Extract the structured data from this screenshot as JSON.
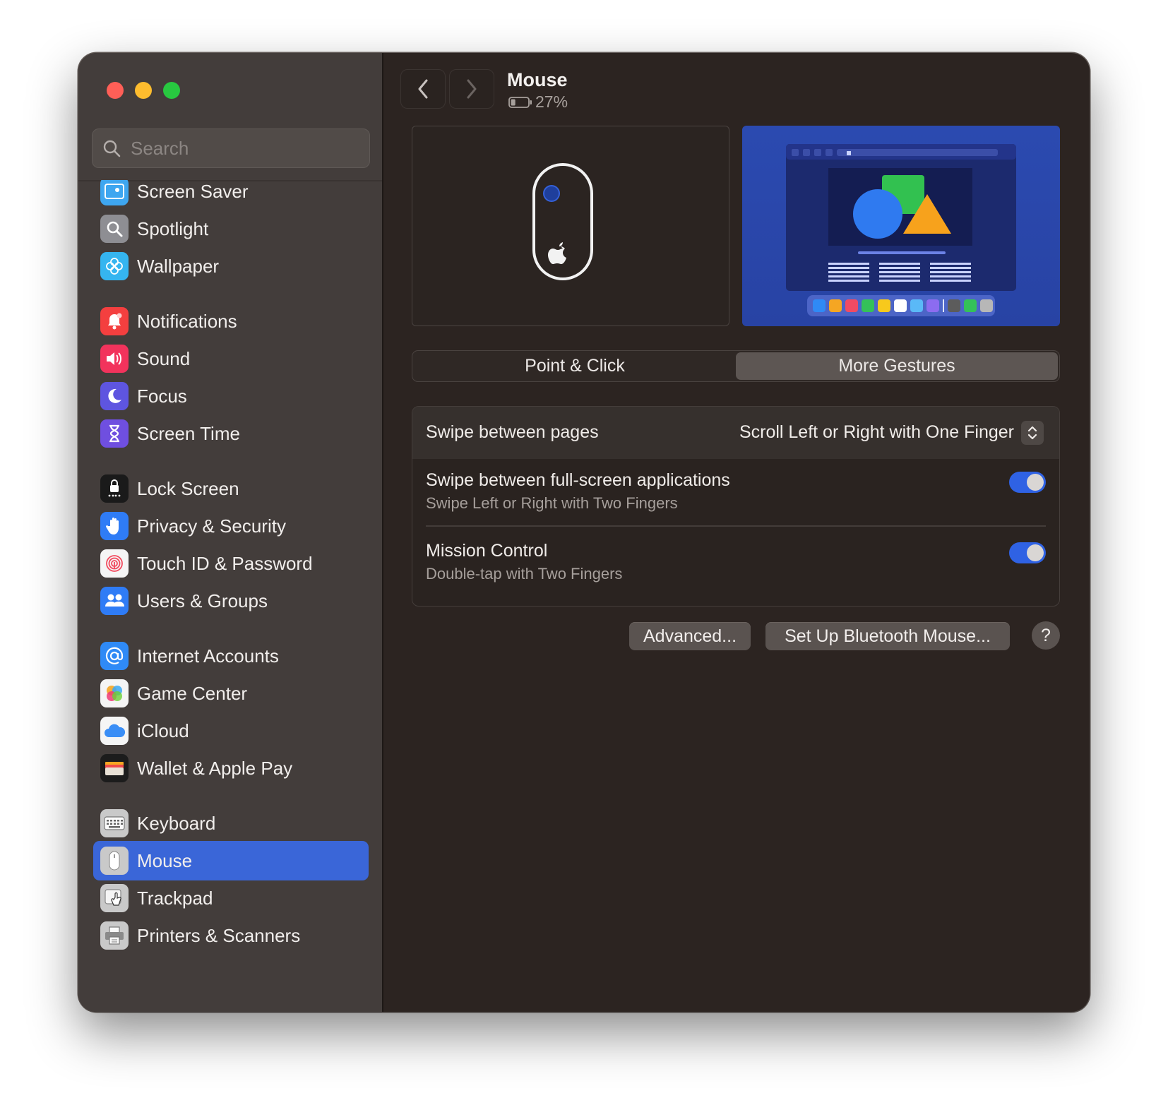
{
  "window": {
    "title": "Mouse"
  },
  "search": {
    "placeholder": "Search"
  },
  "sidebar": {
    "items": [
      {
        "label": "Screen Saver",
        "icon": "screen-saver-icon",
        "color": "#3ea6f0"
      },
      {
        "label": "Spotlight",
        "icon": "spotlight-icon",
        "color": "#8e8e93"
      },
      {
        "label": "Wallpaper",
        "icon": "wallpaper-icon",
        "color": "#35b5f0"
      },
      {
        "label": "Notifications",
        "icon": "notifications-icon",
        "color": "#f43f3f"
      },
      {
        "label": "Sound",
        "icon": "sound-icon",
        "color": "#f2335c"
      },
      {
        "label": "Focus",
        "icon": "focus-icon",
        "color": "#5e55e0"
      },
      {
        "label": "Screen Time",
        "icon": "screen-time-icon",
        "color": "#6f4fe0"
      },
      {
        "label": "Lock Screen",
        "icon": "lock-screen-icon",
        "color": "#1a1a1a"
      },
      {
        "label": "Privacy & Security",
        "icon": "privacy-hand-icon",
        "color": "#2f7cf6"
      },
      {
        "label": "Touch ID & Password",
        "icon": "touch-id-icon",
        "color": "#f5f5f5"
      },
      {
        "label": "Users & Groups",
        "icon": "users-groups-icon",
        "color": "#2f7cf6"
      },
      {
        "label": "Internet Accounts",
        "icon": "internet-accounts-icon",
        "color": "#2f8af6"
      },
      {
        "label": "Game Center",
        "icon": "game-center-icon",
        "color": "#f5f5f5"
      },
      {
        "label": "iCloud",
        "icon": "icloud-icon",
        "color": "#f5f5f5"
      },
      {
        "label": "Wallet & Apple Pay",
        "icon": "wallet-icon",
        "color": "#1c1c1c"
      },
      {
        "label": "Keyboard",
        "icon": "keyboard-icon",
        "color": "#c9c9c9"
      },
      {
        "label": "Mouse",
        "icon": "mouse-icon",
        "color": "#c9c9c9",
        "selected": true
      },
      {
        "label": "Trackpad",
        "icon": "trackpad-icon",
        "color": "#c9c9c9"
      },
      {
        "label": "Printers & Scanners",
        "icon": "printer-icon",
        "color": "#c9c9c9"
      }
    ]
  },
  "header": {
    "back_icon": "chevron-left-icon",
    "forward_icon": "chevron-right-icon",
    "title": "Mouse",
    "battery": "27%",
    "battery_level": 0.27
  },
  "tabs": [
    {
      "label": "Point & Click",
      "selected": false
    },
    {
      "label": "More Gestures",
      "selected": true
    }
  ],
  "settings": {
    "swipe_pages": {
      "label": "Swipe between pages",
      "value": "Scroll Left or Right with One Finger"
    },
    "swipe_fullscreen": {
      "label": "Swipe between full-screen applications",
      "sublabel": "Swipe Left or Right with Two Fingers",
      "enabled": true
    },
    "mission_control": {
      "label": "Mission Control",
      "sublabel": "Double-tap with Two Fingers",
      "enabled": true
    }
  },
  "buttons": {
    "advanced": "Advanced...",
    "setup_bluetooth": "Set Up Bluetooth Mouse...",
    "help": "?"
  },
  "colors": {
    "accent": "#3a66d8",
    "toggle_on": "#2f62e4"
  }
}
